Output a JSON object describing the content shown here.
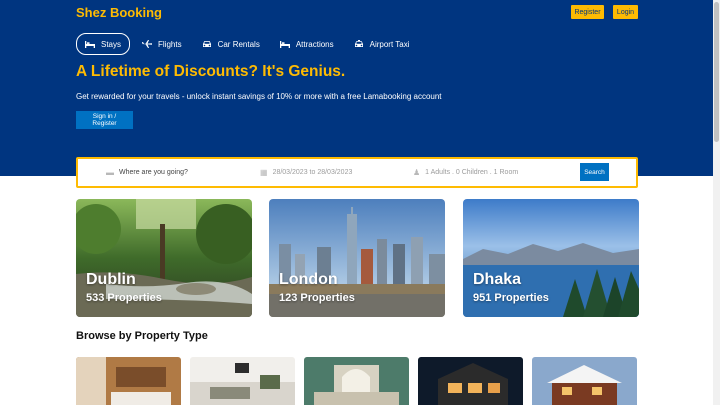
{
  "app": {
    "logo": "Shez Booking"
  },
  "header": {
    "register_label": "Register",
    "login_label": "Login"
  },
  "nav": {
    "items": [
      {
        "label": "Stays",
        "icon": "bed-icon",
        "active": true
      },
      {
        "label": "Flights",
        "icon": "plane-icon",
        "active": false
      },
      {
        "label": "Car Rentals",
        "icon": "car-icon",
        "active": false
      },
      {
        "label": "Attractions",
        "icon": "bed-icon",
        "active": false
      },
      {
        "label": "Airport Taxi",
        "icon": "taxi-icon",
        "active": false
      }
    ]
  },
  "hero": {
    "title": "A Lifetime of Discounts? It's Genius.",
    "subtitle": "Get rewarded for your travels - unlock instant savings of 10% or more with a free Lamabooking account",
    "signin_label": "Sign in / Register"
  },
  "search": {
    "destination_placeholder": "Where are you going?",
    "dates": "28/03/2023 to 28/03/2023",
    "guests": "1 Adults . 0 Children . 1 Room",
    "button_label": "Search"
  },
  "featured": [
    {
      "city": "Dublin",
      "count": "533 Properties"
    },
    {
      "city": "London",
      "count": "123 Properties"
    },
    {
      "city": "Dhaka",
      "count": "951 Properties"
    }
  ],
  "property_section": {
    "title": "Browse by Property Type"
  },
  "colors": {
    "header_bg": "#003580",
    "accent": "#febb02",
    "button_blue": "#0071c2"
  }
}
